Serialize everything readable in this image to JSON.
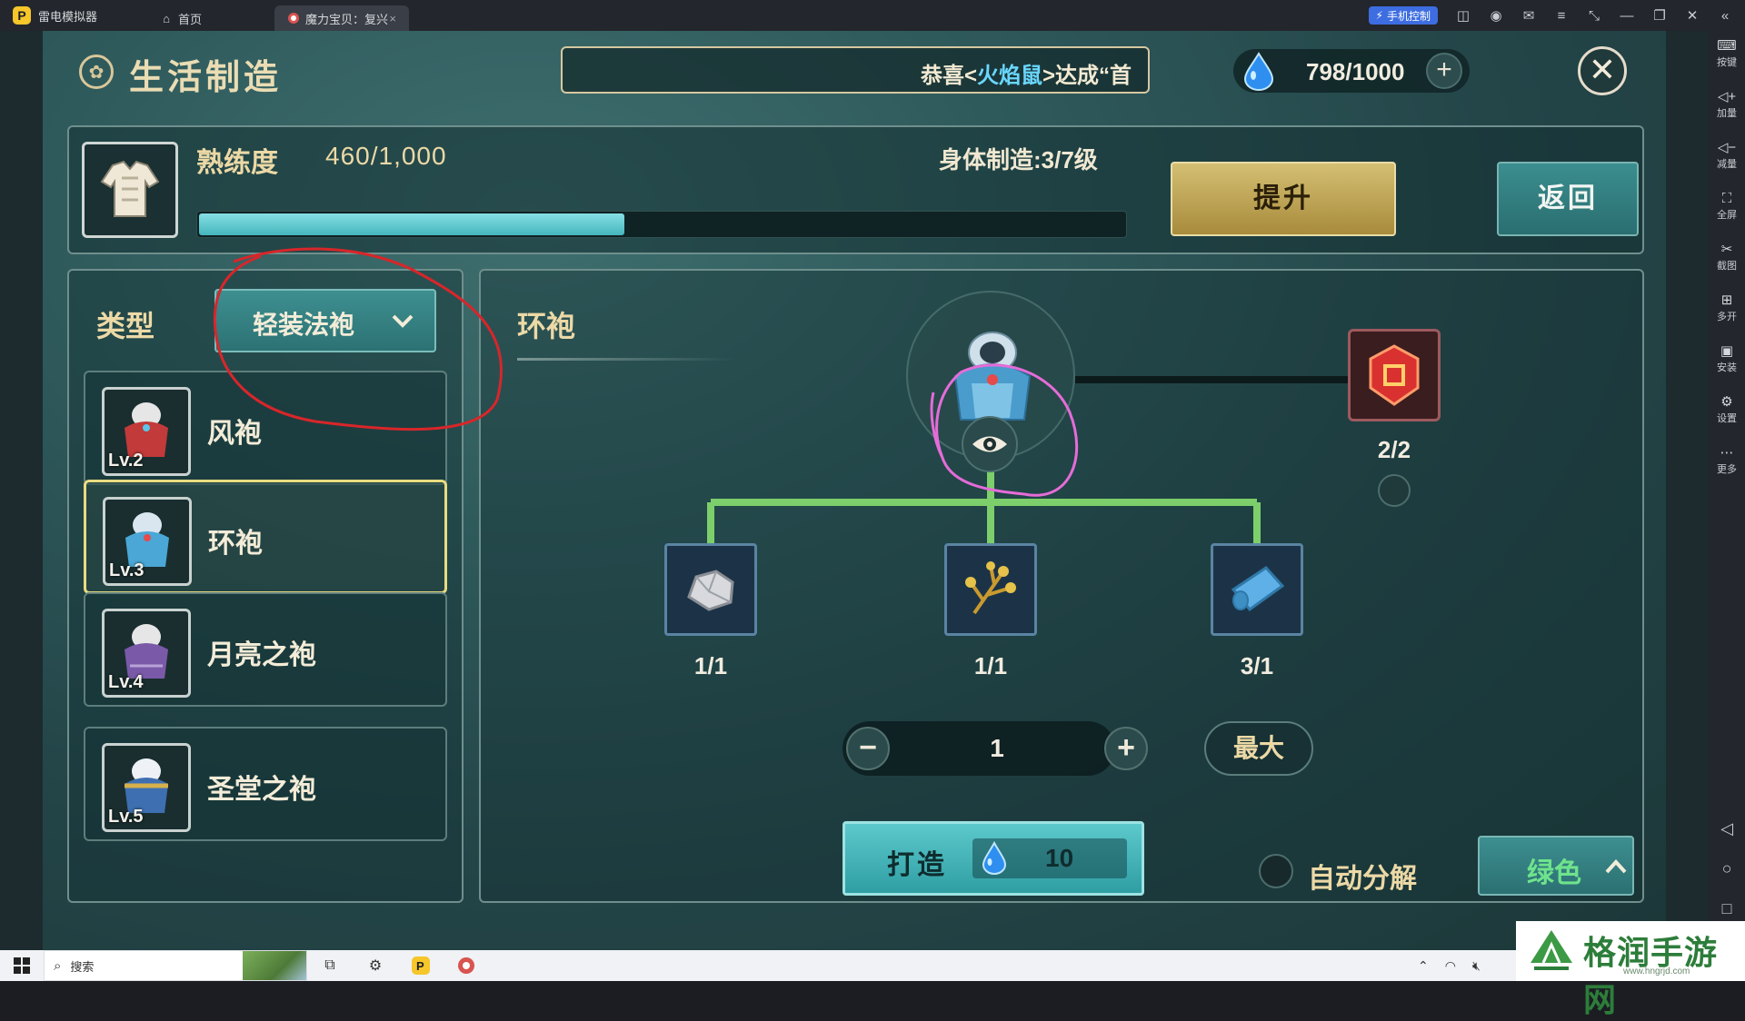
{
  "titlebar": {
    "app_name": "雷电模拟器",
    "tabs": [
      {
        "label": "首页"
      },
      {
        "label": "魔力宝贝：复兴",
        "close": "×"
      }
    ],
    "phone_control": "手机控制"
  },
  "rightbar": {
    "items": [
      "按键",
      "加量",
      "减量",
      "全屏",
      "截图",
      "多开",
      "安装",
      "设置",
      "更多"
    ]
  },
  "game": {
    "title": "生活制造",
    "announcement": {
      "prefix": "恭喜<",
      "name": "火焰鼠",
      "suffix": ">达成“首"
    },
    "energy": {
      "value": "798/1000",
      "plus": "+"
    },
    "close": "✕",
    "proficiency": {
      "label": "熟练度",
      "value": "460/1,000",
      "progress_fraction": 0.46,
      "body_level": "身体制造:3/7级",
      "upgrade": "提升",
      "return": "返回"
    },
    "list": {
      "type_label": "类型",
      "type_value": "轻装法袍",
      "recipes": [
        {
          "name": "风袍",
          "level": "Lv.2",
          "color": "#c23a3a",
          "selected": false
        },
        {
          "name": "环袍",
          "level": "Lv.3",
          "color": "#4aa7d6",
          "selected": true
        },
        {
          "name": "月亮之袍",
          "level": "Lv.4",
          "color": "#7a5aa8",
          "selected": false
        },
        {
          "name": "圣堂之袍",
          "level": "Lv.5",
          "color": "#d6b04a",
          "selected": false
        }
      ]
    },
    "craft": {
      "title": "环袍",
      "gem_count": "2/2",
      "materials": [
        {
          "icon": "ore-icon",
          "count": "1/1"
        },
        {
          "icon": "herb-icon",
          "count": "1/1"
        },
        {
          "icon": "cloth-icon",
          "count": "3/1"
        }
      ],
      "quantity": {
        "minus": "−",
        "value": "1",
        "plus": "+"
      },
      "max": "最大",
      "craft_button": {
        "label": "打造",
        "cost": "10"
      },
      "auto_decompose": "自动分解",
      "quality": "绿色"
    }
  },
  "taskbar": {
    "search": "搜索"
  },
  "watermark": {
    "text": "格润手游网",
    "sub": "www.hngrjd.com"
  },
  "colors": {
    "accent_gold": "#ecd9a6",
    "teal_button": "#3e8f90",
    "quality_green": "#6fe38c",
    "annotation_red": "#d8262a",
    "annotation_pink": "#e56cd8"
  }
}
